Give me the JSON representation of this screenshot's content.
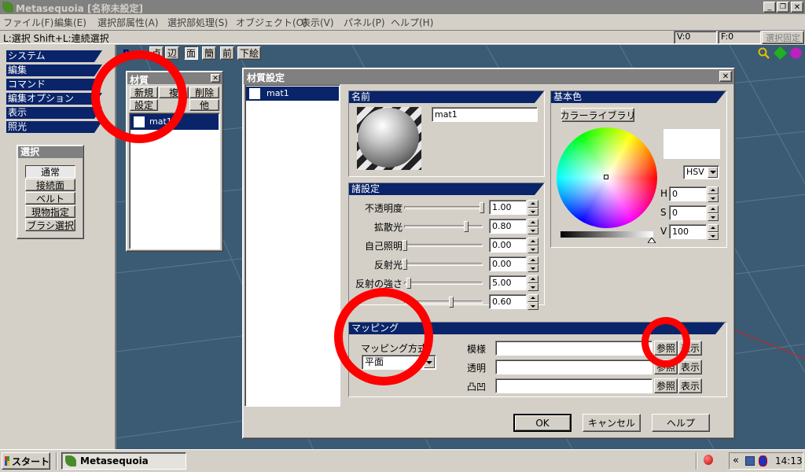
{
  "app": {
    "title": "Metasequoia [名称未設定]"
  },
  "menubar": [
    "ファイル(F)",
    "編集(E)",
    "選択部属性(A)",
    "選択部処理(S)",
    "オブジェクト(O)",
    "表示(V)",
    "パネル(P)",
    "ヘルプ(H)"
  ],
  "statusbar": {
    "hint": "L:選択  Shift+L:連続選択",
    "v": "V:0",
    "f": "F:0",
    "lock": "選択固定"
  },
  "left_nav": [
    "システム",
    "編集",
    "コマンド",
    "編集オプション",
    "表示",
    "照光"
  ],
  "select_panel": {
    "title": "選択",
    "buttons": [
      "通常",
      "接続面",
      "ベルト",
      "現物指定",
      "ブラシ選択"
    ]
  },
  "view_toolbar": {
    "persp": "Pers",
    "buttons": [
      "点",
      "辺",
      "面",
      "簡",
      "前",
      "下絵"
    ]
  },
  "material_panel": {
    "title": "材質",
    "buttons": [
      "新規",
      "複",
      "削除",
      "設定",
      "他"
    ],
    "items": [
      "mat1"
    ]
  },
  "dialog": {
    "title": "材質設定",
    "list": [
      "mat1"
    ],
    "name_section": {
      "header": "名前",
      "value": "mat1"
    },
    "settings_section": {
      "header": "諸設定",
      "rows": [
        {
          "label": "不透明度",
          "value": "1.00",
          "pos": 1.0
        },
        {
          "label": "拡散光",
          "value": "0.80",
          "pos": 0.8
        },
        {
          "label": "自己照明",
          "value": "0.00",
          "pos": 0.0
        },
        {
          "label": "反射光",
          "value": "0.00",
          "pos": 0.0
        },
        {
          "label": "反射の強さ",
          "value": "5.00",
          "pos": 0.05
        },
        {
          "label": "",
          "value": "0.60",
          "pos": 0.6
        }
      ]
    },
    "color_section": {
      "header": "基本色",
      "library_button": "カラーライブラリ",
      "mode": "HSV",
      "h_label": "H",
      "h": "0",
      "s_label": "S",
      "s": "0",
      "v_label": "V",
      "v": "100",
      "swatch": "#ffffff"
    },
    "mapping_section": {
      "header": "マッピング",
      "method_label": "マッピング方式",
      "method_value": "平面",
      "rows": [
        {
          "label": "模様",
          "ref": "参照",
          "show": "表示"
        },
        {
          "label": "透明",
          "ref": "参照",
          "show": "表示"
        },
        {
          "label": "凸凹",
          "ref": "参照",
          "show": "表示"
        }
      ]
    },
    "buttons": {
      "ok": "OK",
      "cancel": "キャンセル",
      "help": "ヘルプ"
    }
  },
  "taskbar": {
    "start": "スタート",
    "task": "Metasequoia",
    "tray_chevron": "«",
    "time": "14:13"
  },
  "colors": {
    "title_bar": "#808080",
    "nav_blue": "#0a246a",
    "viewport": "#3b5a74",
    "annotation": "#ff0000"
  }
}
